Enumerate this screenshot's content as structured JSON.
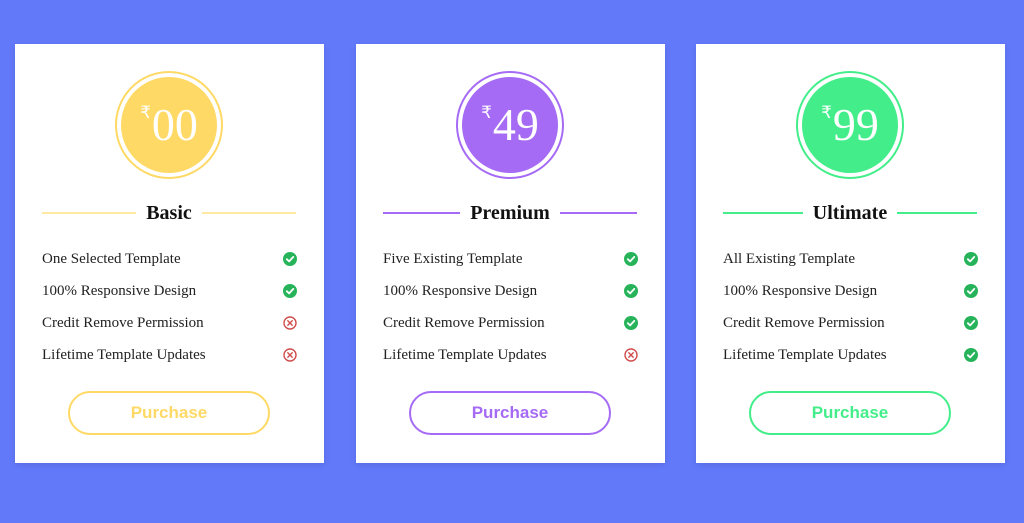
{
  "plans": [
    {
      "currency": "₹",
      "price": "00",
      "name": "Basic",
      "accent": "#ffd966",
      "line": "#ffe9a0",
      "features": [
        {
          "label": "One Selected Template",
          "included": true
        },
        {
          "label": "100% Responsive Design",
          "included": true
        },
        {
          "label": "Credit Remove Permission",
          "included": false
        },
        {
          "label": "Lifetime Template Updates",
          "included": false
        }
      ],
      "button_label": "Purchase"
    },
    {
      "currency": "₹",
      "price": "49",
      "name": "Premium",
      "accent": "#a66bf5",
      "line": "#a66bf5",
      "features": [
        {
          "label": "Five Existing Template",
          "included": true
        },
        {
          "label": "100% Responsive Design",
          "included": true
        },
        {
          "label": "Credit Remove Permission",
          "included": true
        },
        {
          "label": "Lifetime Template Updates",
          "included": false
        }
      ],
      "button_label": "Purchase"
    },
    {
      "currency": "₹",
      "price": "99",
      "name": "Ultimate",
      "accent": "#43ee8a",
      "line": "#43ee8a",
      "features": [
        {
          "label": "All Existing Template",
          "included": true
        },
        {
          "label": "100% Responsive Design",
          "included": true
        },
        {
          "label": "Credit Remove Permission",
          "included": true
        },
        {
          "label": "Lifetime Template Updates",
          "included": true
        }
      ],
      "button_label": "Purchase"
    }
  ],
  "icons": {
    "included": "check-circle-icon",
    "excluded": "x-circle-icon"
  },
  "colors": {
    "background": "#6279fa",
    "check": "#27b35a",
    "cross": "#d14b4b"
  }
}
